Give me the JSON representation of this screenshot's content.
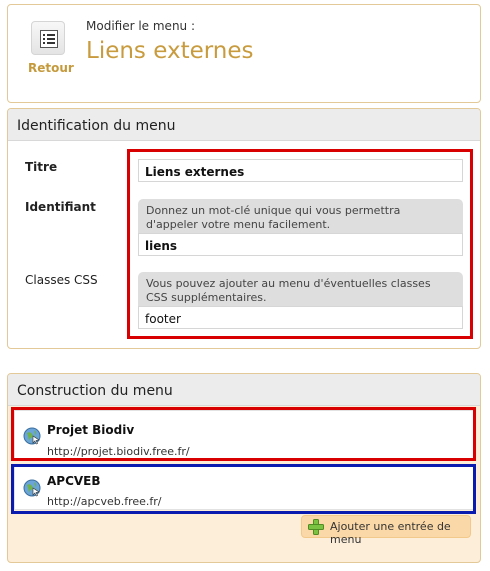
{
  "header": {
    "back_label": "Retour",
    "subtitle": "Modifier le menu :",
    "title": "Liens externes"
  },
  "identification": {
    "heading": "Identification du menu",
    "titre_label": "Titre",
    "titre_value": "Liens externes",
    "identifiant_label": "Identifiant",
    "identifiant_help": "Donnez un mot-clé unique qui vous permettra d'appeler votre menu facilement.",
    "identifiant_value": "liens",
    "classes_label": "Classes CSS",
    "classes_help": "Vous pouvez ajouter au menu d'éventuelles classes CSS supplémentaires.",
    "classes_value": "footer"
  },
  "construction": {
    "heading": "Construction du menu",
    "entries": [
      {
        "name": "Projet Biodiv",
        "url": "http://projet.biodiv.free.fr/"
      },
      {
        "name": "APCVEB",
        "url": "http://apcveb.free.fr/"
      }
    ],
    "add_label": "Ajouter une entrée de menu"
  },
  "colors": {
    "accent": "#c89b3e",
    "highlight_red": "#d80000",
    "highlight_blue": "#0a1bb0",
    "panel_border": "#e2c997"
  },
  "icons": {
    "back": "list-menu-icon",
    "entry": "web-link-globe-icon",
    "add": "green-plus-icon"
  }
}
